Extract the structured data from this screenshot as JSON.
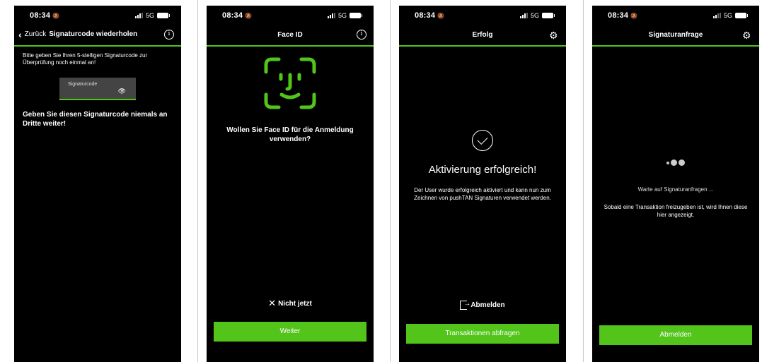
{
  "screens": [
    {
      "status": {
        "time": "08:34",
        "network": "5G"
      },
      "nav": {
        "back_label": "Zurück",
        "title": "Signaturcode wiederholen",
        "right_icon": "info-icon"
      },
      "instruction": "Bitte geben Sie Ihren 5-stelligen Signaturcode zur Überprüfung noch einmal an!",
      "field": {
        "label": "Signaturcode",
        "icon": "eye-icon"
      },
      "warning": "Geben Sie diesen Signaturcode niemals an Dritte weiter!"
    },
    {
      "status": {
        "time": "08:34",
        "network": "5G"
      },
      "nav": {
        "title": "Face ID",
        "right_icon": "info-icon"
      },
      "face_icon": "face-id-icon",
      "question": "Wollen Sie Face ID für die Anmeldung verwenden?",
      "skip_label": "Nicht jetzt",
      "button_label": "Weiter"
    },
    {
      "status": {
        "time": "08:34",
        "network": "5G"
      },
      "nav": {
        "title": "Erfolg",
        "right_icon": "gear-icon"
      },
      "heading": "Aktivierung erfolgreich!",
      "description": "Der User wurde erfolgreich aktiviert und kann nun zum Zeichnen von pushTAN Signaturen verwendet werden.",
      "logout_label": "Abmelden",
      "button_label": "Transaktionen abfragen"
    },
    {
      "status": {
        "time": "08:34",
        "network": "5G"
      },
      "nav": {
        "title": "Signaturanfrage",
        "right_icon": "gear-icon"
      },
      "waiting": "Warte auf Signaturanfragen ...",
      "description": "Sobald eine Transaktion freizugeben ist, wird Ihnen diese hier angezeigt.",
      "button_label": "Abmelden"
    }
  ],
  "colors": {
    "accent": "#52c41a",
    "background": "#000000",
    "field": "#444444"
  }
}
